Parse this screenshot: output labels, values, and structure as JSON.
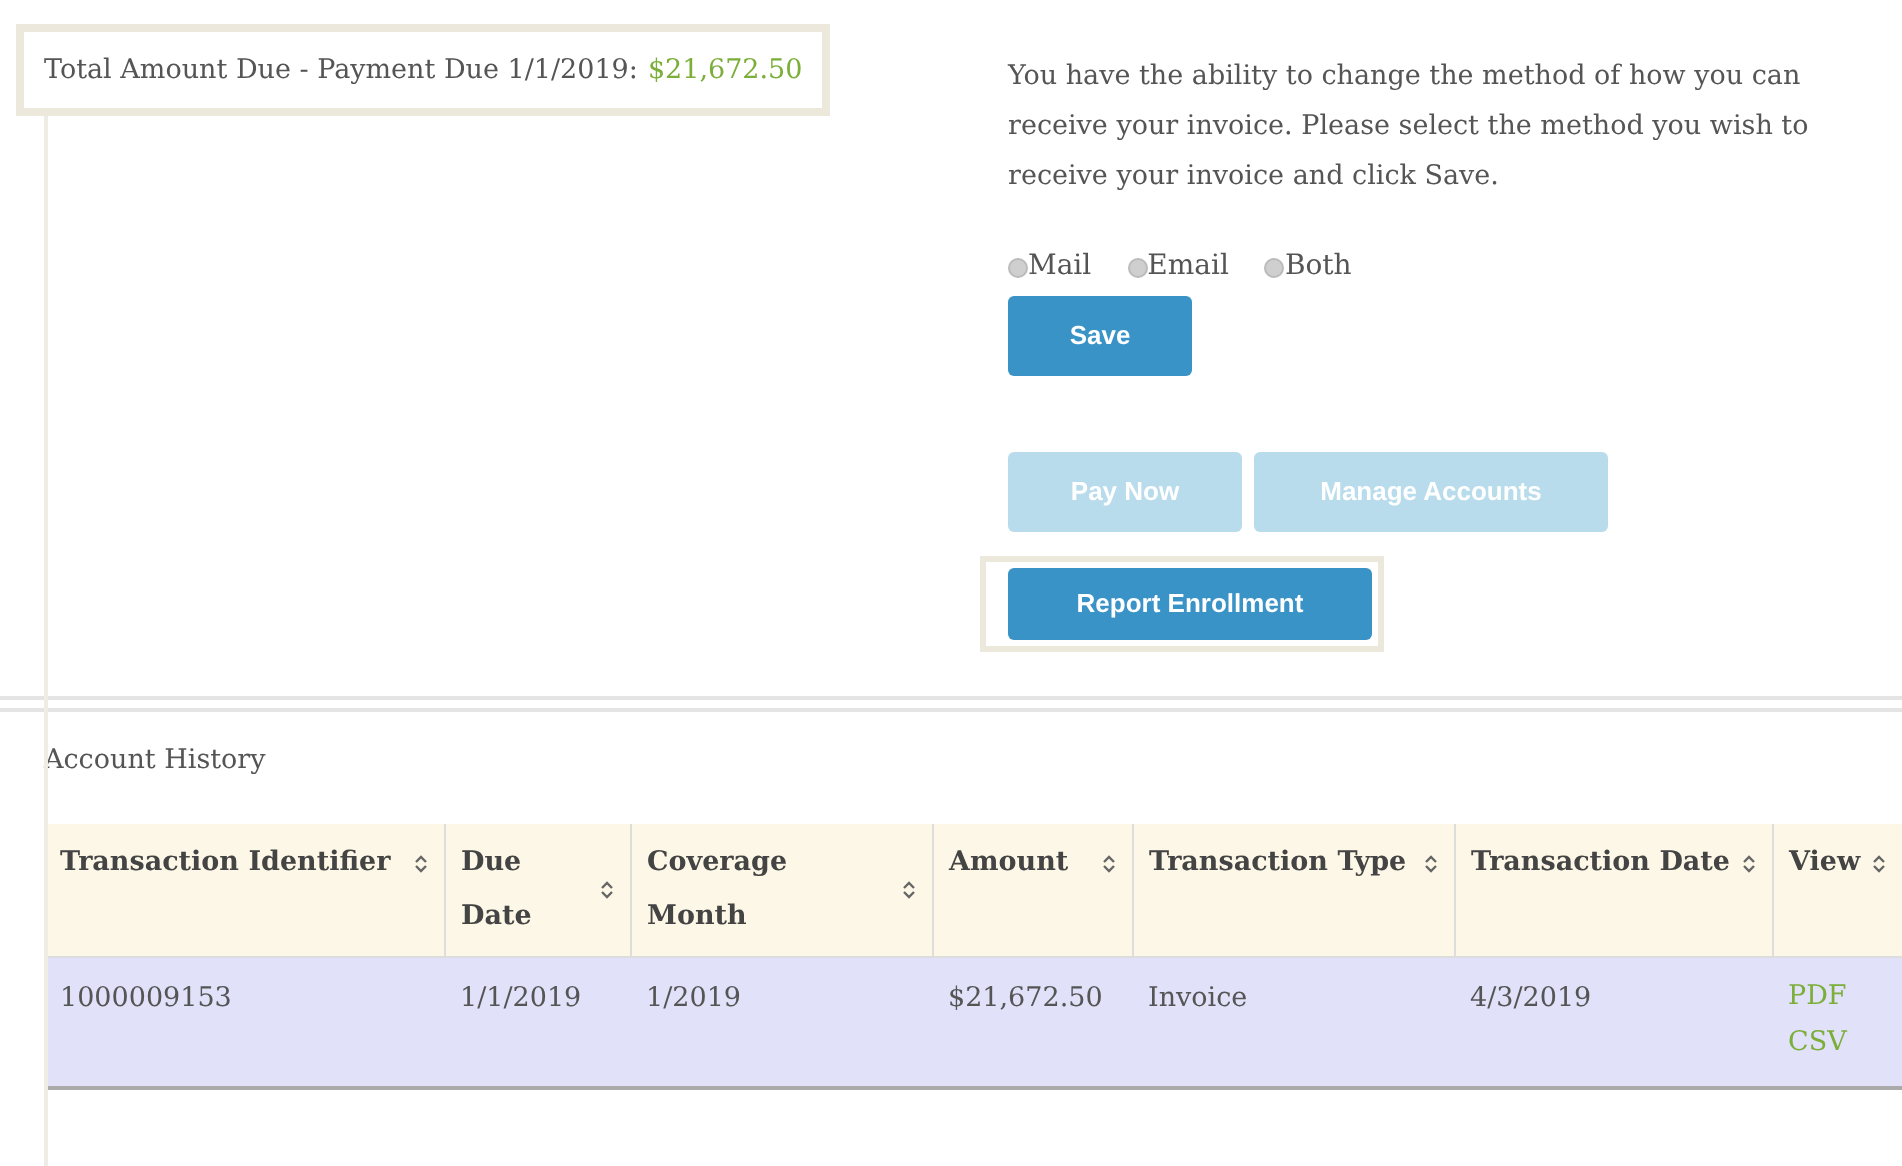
{
  "total_due": {
    "label": "Total Amount Due - Payment Due 1/1/2019:",
    "amount": "$21,672.50"
  },
  "invoice_method": {
    "instructions": "You have the ability to change the method of how you can receive your invoice. Please select the method you wish to receive your invoice and click Save.",
    "options": [
      {
        "label": "Mail",
        "selected": false
      },
      {
        "label": "Email",
        "selected": false
      },
      {
        "label": "Both",
        "selected": false
      }
    ],
    "save_button": "Save"
  },
  "action_buttons": [
    {
      "label": "Pay Now",
      "disabled": true
    },
    {
      "label": "Manage Accounts",
      "disabled": true
    }
  ],
  "report_button": {
    "label": "Report Enrollment",
    "disabled": false
  },
  "account_history": {
    "title": "Account History",
    "columns": [
      "Transaction Identifier",
      "Due Date",
      "Coverage Month",
      "Amount",
      "Transaction Type",
      "Transaction Date",
      "View"
    ],
    "rows": [
      {
        "cells": [
          "1000009153",
          "1/1/2019",
          "1/2019",
          "$21,672.50",
          "Invoice",
          "4/3/2019"
        ],
        "links": [
          "PDF",
          "CSV"
        ]
      }
    ]
  }
}
